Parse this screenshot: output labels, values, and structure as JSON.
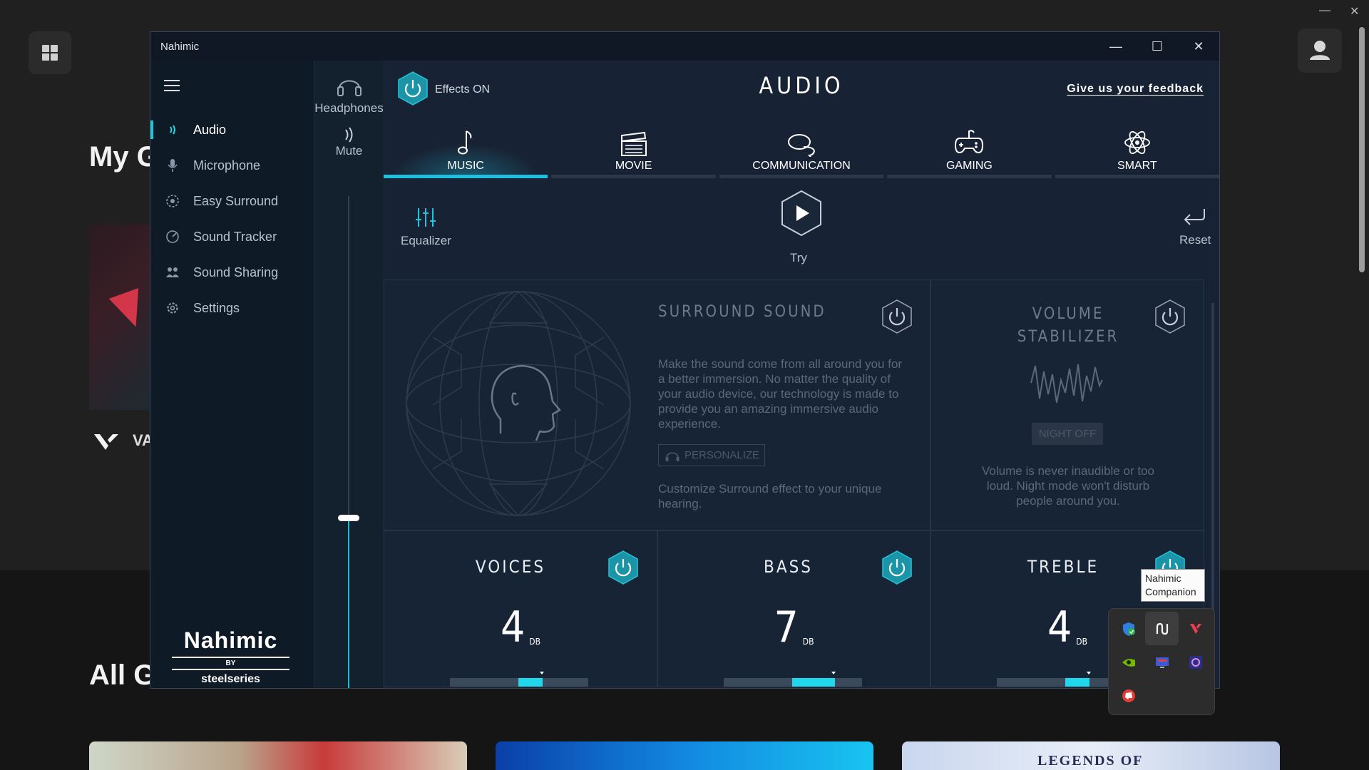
{
  "launcher": {
    "heading_my": "My G",
    "heading_all": "All G",
    "game_label": "VA",
    "card3_title": "LEGENDS OF"
  },
  "window": {
    "title": "Nahimic",
    "minimize": "—",
    "maximize": "☐",
    "close": "✕"
  },
  "sidebar": {
    "items": [
      {
        "label": "Audio",
        "icon": "audio-waves-icon",
        "glyph": "⦆"
      },
      {
        "label": "Microphone",
        "icon": "microphone-icon",
        "glyph": "🎙"
      },
      {
        "label": "Easy Surround",
        "icon": "surround-icon",
        "glyph": "◉"
      },
      {
        "label": "Sound Tracker",
        "icon": "radar-icon",
        "glyph": "◔"
      },
      {
        "label": "Sound Sharing",
        "icon": "sharing-icon",
        "glyph": "⁂"
      },
      {
        "label": "Settings",
        "icon": "gear-icon",
        "glyph": "⚙"
      }
    ],
    "logo_text": "Nahimic",
    "logo_by": "BY",
    "logo_brand": "steelseries"
  },
  "device": {
    "name": "Headphones",
    "mute_label": "Mute",
    "volume_level": 0.35
  },
  "header": {
    "effects_label": "Effects ON",
    "title": "AUDIO",
    "feedback_link": "Give us your feedback"
  },
  "tabs": [
    {
      "label": "MUSIC",
      "icon": "music-note-icon",
      "active": true
    },
    {
      "label": "MOVIE",
      "icon": "clapperboard-icon",
      "active": false
    },
    {
      "label": "COMMUNICATION",
      "icon": "chat-bubbles-icon",
      "active": false
    },
    {
      "label": "GAMING",
      "icon": "gamepad-icon",
      "active": false
    },
    {
      "label": "SMART",
      "icon": "atom-icon",
      "active": false
    }
  ],
  "tools": {
    "equalizer_label": "Equalizer",
    "try_label": "Try",
    "reset_label": "Reset"
  },
  "surround": {
    "title": "SURROUND SOUND",
    "description": "Make the sound come from all around you for a better immersion. No matter the quality of your audio device, our technology is made to provide you an amazing immersive audio experience.",
    "personalize_label": "PERSONALIZE",
    "customize_text": "Customize Surround effect to your unique hearing."
  },
  "stabilizer": {
    "title_line1": "VOLUME",
    "title_line2": "STABILIZER",
    "night_label": "NIGHT OFF",
    "description": "Volume is never inaudible or too loud. Night mode won't disturb people around you."
  },
  "eq_bands": [
    {
      "title": "VOICES",
      "value": "4",
      "unit": "DB",
      "level": 0.5
    },
    {
      "title": "BASS",
      "value": "7",
      "unit": "DB",
      "level": 0.62
    },
    {
      "title": "TREBLE",
      "value": "4",
      "unit": "DB",
      "level": 0.5
    }
  ],
  "tooltip": {
    "line1": "Nahimic",
    "line2": "Companion"
  },
  "colors": {
    "accent": "#1fbfe0",
    "window_bg": "#172334",
    "sidebar_bg": "#0f1a27"
  }
}
